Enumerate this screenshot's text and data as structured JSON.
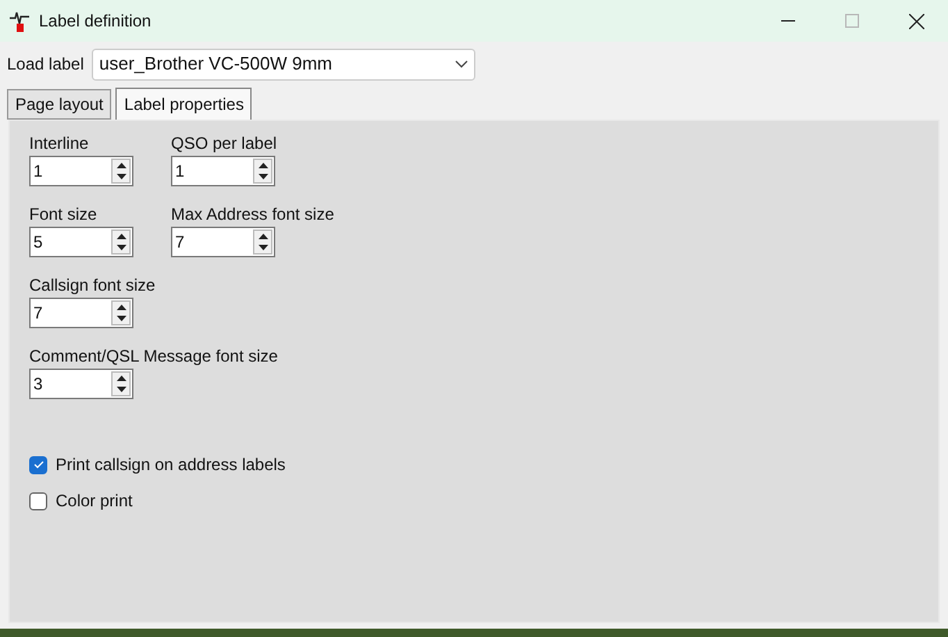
{
  "window": {
    "title": "Label definition",
    "controls": [
      {
        "kind": "minimize",
        "disabled": false
      },
      {
        "kind": "maximize",
        "disabled": true
      },
      {
        "kind": "close",
        "disabled": false
      }
    ]
  },
  "load_label": {
    "label": "Load label",
    "value": "user_Brother VC-500W 9mm"
  },
  "tabs": [
    {
      "label": "Page layout",
      "selected": false
    },
    {
      "label": "Label properties",
      "selected": true
    }
  ],
  "fields": [
    [
      {
        "label": "Interline",
        "value": "1"
      },
      {
        "label": "QSO per label",
        "value": "1"
      }
    ],
    [
      {
        "label": "Font size",
        "value": "5"
      },
      {
        "label": "Max Address font size",
        "value": "7"
      }
    ],
    [
      {
        "label": "Callsign font size",
        "value": "7"
      }
    ],
    [
      {
        "label": "Comment/QSL Message font size",
        "value": "3"
      }
    ]
  ],
  "checkboxes": [
    {
      "label": "Print callsign on address labels",
      "checked": true
    },
    {
      "label": "Color print",
      "checked": false
    }
  ]
}
